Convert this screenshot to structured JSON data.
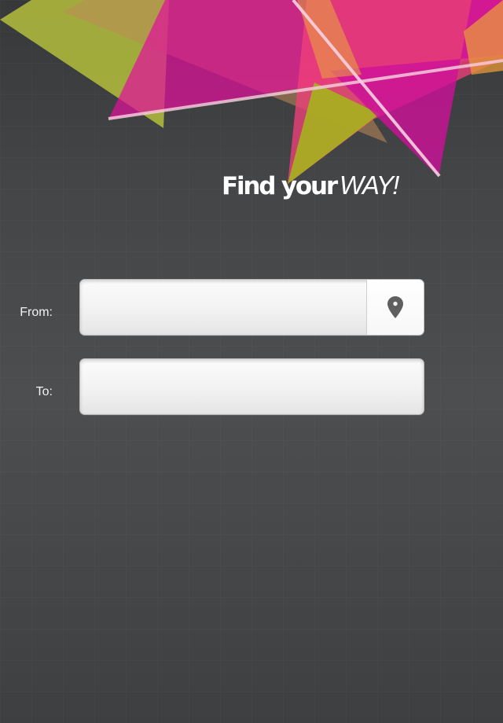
{
  "header": {
    "title_strong": "Find your",
    "title_italic": "WAY!"
  },
  "form": {
    "from": {
      "label": "From:",
      "value": "",
      "placeholder": ""
    },
    "to": {
      "label": "To:",
      "value": "",
      "placeholder": ""
    },
    "locate_button": {
      "icon": "map-pin-icon"
    }
  },
  "colors": {
    "background": "#46484a",
    "accent_magenta": "#e0109a",
    "accent_pink": "#f0407a",
    "accent_olive": "#b4be3c",
    "accent_orange": "#e89a3a",
    "field_fill": "#f4f4f4",
    "icon": "#5f5f5f"
  }
}
